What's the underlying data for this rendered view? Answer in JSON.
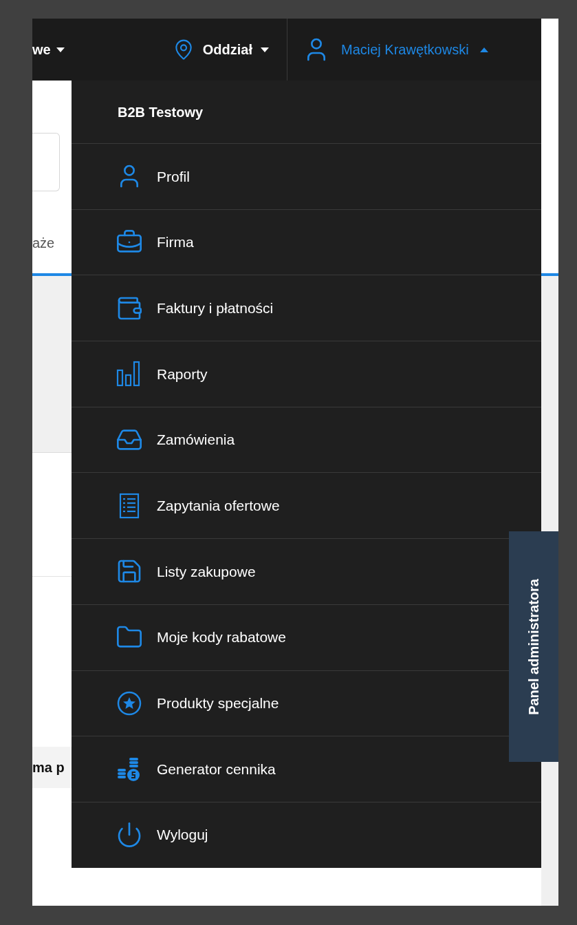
{
  "top_bar": {
    "items": [
      {
        "label": "we",
        "kind": "dropdown"
      },
      {
        "label": "Oddział",
        "kind": "location"
      }
    ],
    "user": {
      "name": "Maciej Krawętkowski",
      "expanded": true
    }
  },
  "background_page": {
    "tab_label": "aże",
    "table_cell": "ma p"
  },
  "user_menu": {
    "title": "B2B Testowy",
    "items": [
      {
        "label": "Profil"
      },
      {
        "label": "Firma"
      },
      {
        "label": "Faktury i płatności"
      },
      {
        "label": "Raporty"
      },
      {
        "label": "Zamówienia"
      },
      {
        "label": "Zapytania ofertowe"
      },
      {
        "label": "Listy zakupowe"
      },
      {
        "label": "Moje kody rabatowe"
      },
      {
        "label": "Produkty specjalne"
      },
      {
        "label": "Generator cennika"
      },
      {
        "label": "Wyloguj"
      }
    ]
  },
  "admin_tab": {
    "label": "Panel administratora"
  }
}
